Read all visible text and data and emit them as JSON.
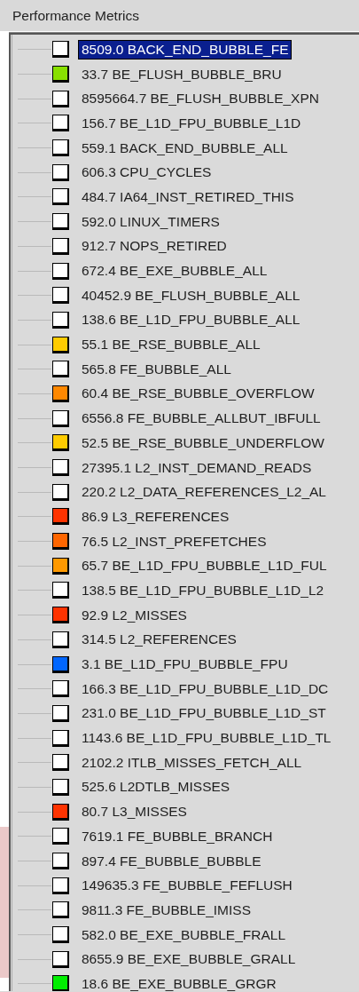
{
  "panel": {
    "title": "Performance Metrics"
  },
  "metrics": [
    {
      "label": "8509.0 BACK_END_BUBBLE_FE",
      "color": "#ffffff",
      "selected": true
    },
    {
      "label": "33.7 BE_FLUSH_BUBBLE_BRU",
      "color": "#88e000",
      "selected": false
    },
    {
      "label": "8595664.7 BE_FLUSH_BUBBLE_XPN",
      "color": "#ffffff",
      "selected": false
    },
    {
      "label": "156.7 BE_L1D_FPU_BUBBLE_L1D",
      "color": "#ffffff",
      "selected": false
    },
    {
      "label": "559.1 BACK_END_BUBBLE_ALL",
      "color": "#ffffff",
      "selected": false
    },
    {
      "label": "606.3 CPU_CYCLES",
      "color": "#ffffff",
      "selected": false
    },
    {
      "label": "484.7 IA64_INST_RETIRED_THIS",
      "color": "#ffffff",
      "selected": false
    },
    {
      "label": "592.0 LINUX_TIMERS",
      "color": "#ffffff",
      "selected": false
    },
    {
      "label": "912.7 NOPS_RETIRED",
      "color": "#ffffff",
      "selected": false
    },
    {
      "label": "672.4 BE_EXE_BUBBLE_ALL",
      "color": "#ffffff",
      "selected": false
    },
    {
      "label": "40452.9 BE_FLUSH_BUBBLE_ALL",
      "color": "#ffffff",
      "selected": false
    },
    {
      "label": "138.6 BE_L1D_FPU_BUBBLE_ALL",
      "color": "#ffffff",
      "selected": false
    },
    {
      "label": "55.1 BE_RSE_BUBBLE_ALL",
      "color": "#ffcc00",
      "selected": false
    },
    {
      "label": "565.8 FE_BUBBLE_ALL",
      "color": "#ffffff",
      "selected": false
    },
    {
      "label": "60.4 BE_RSE_BUBBLE_OVERFLOW",
      "color": "#ff8800",
      "selected": false
    },
    {
      "label": "6556.8 FE_BUBBLE_ALLBUT_IBFULL",
      "color": "#ffffff",
      "selected": false
    },
    {
      "label": "52.5 BE_RSE_BUBBLE_UNDERFLOW",
      "color": "#ffcc00",
      "selected": false
    },
    {
      "label": "27395.1 L2_INST_DEMAND_READS",
      "color": "#ffffff",
      "selected": false
    },
    {
      "label": "220.2 L2_DATA_REFERENCES_L2_AL",
      "color": "#ffffff",
      "selected": false
    },
    {
      "label": "86.9 L3_REFERENCES",
      "color": "#ff3300",
      "selected": false
    },
    {
      "label": "76.5 L2_INST_PREFETCHES",
      "color": "#ff6600",
      "selected": false
    },
    {
      "label": "65.7 BE_L1D_FPU_BUBBLE_L1D_FUL",
      "color": "#ff9900",
      "selected": false
    },
    {
      "label": "138.5 BE_L1D_FPU_BUBBLE_L1D_L2",
      "color": "#ffffff",
      "selected": false
    },
    {
      "label": "92.9 L2_MISSES",
      "color": "#ff3300",
      "selected": false
    },
    {
      "label": "314.5 L2_REFERENCES",
      "color": "#ffffff",
      "selected": false
    },
    {
      "label": "3.1 BE_L1D_FPU_BUBBLE_FPU",
      "color": "#0066ff",
      "selected": false
    },
    {
      "label": "166.3 BE_L1D_FPU_BUBBLE_L1D_DC",
      "color": "#ffffff",
      "selected": false
    },
    {
      "label": "231.0 BE_L1D_FPU_BUBBLE_L1D_ST",
      "color": "#ffffff",
      "selected": false
    },
    {
      "label": "1143.6 BE_L1D_FPU_BUBBLE_L1D_TL",
      "color": "#ffffff",
      "selected": false
    },
    {
      "label": "2102.2 ITLB_MISSES_FETCH_ALL",
      "color": "#ffffff",
      "selected": false
    },
    {
      "label": "525.6 L2DTLB_MISSES",
      "color": "#ffffff",
      "selected": false
    },
    {
      "label": "80.7 L3_MISSES",
      "color": "#ff3300",
      "selected": false
    },
    {
      "label": "7619.1 FE_BUBBLE_BRANCH",
      "color": "#ffffff",
      "selected": false
    },
    {
      "label": "897.4 FE_BUBBLE_BUBBLE",
      "color": "#ffffff",
      "selected": false
    },
    {
      "label": "149635.3 FE_BUBBLE_FEFLUSH",
      "color": "#ffffff",
      "selected": false
    },
    {
      "label": "9811.3 FE_BUBBLE_IMISS",
      "color": "#ffffff",
      "selected": false
    },
    {
      "label": "582.0 BE_EXE_BUBBLE_FRALL",
      "color": "#ffffff",
      "selected": false
    },
    {
      "label": "8655.9 BE_EXE_BUBBLE_GRALL",
      "color": "#ffffff",
      "selected": false
    },
    {
      "label": "18.6 BE_EXE_BUBBLE_GRGR",
      "color": "#00ee00",
      "selected": false
    }
  ]
}
